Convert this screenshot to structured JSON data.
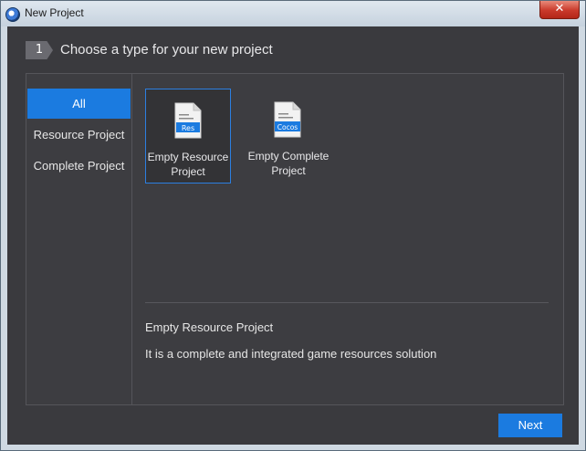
{
  "window": {
    "title": "New Project",
    "close_glyph": "✕",
    "app_icon": "cocos-app-icon"
  },
  "step": {
    "number": "1",
    "title": "Choose a type for your new project"
  },
  "sidebar": {
    "items": [
      {
        "label": "All",
        "active": true
      },
      {
        "label": "Resource Project",
        "active": false
      },
      {
        "label": "Complete Project",
        "active": false
      }
    ]
  },
  "templates": [
    {
      "label_line1": "Empty Resource",
      "label_line2": "Project",
      "badge": "Res",
      "selected": true
    },
    {
      "label_line1": "Empty Complete",
      "label_line2": "Project",
      "badge": "Cocos",
      "selected": false
    }
  ],
  "description": {
    "title": "Empty Resource Project",
    "text": "It is a complete and integrated game resources solution"
  },
  "footer": {
    "next_label": "Next"
  },
  "colors": {
    "accent": "#1b7be0",
    "background": "#3a3a3e",
    "panel": "#3d3d41"
  }
}
